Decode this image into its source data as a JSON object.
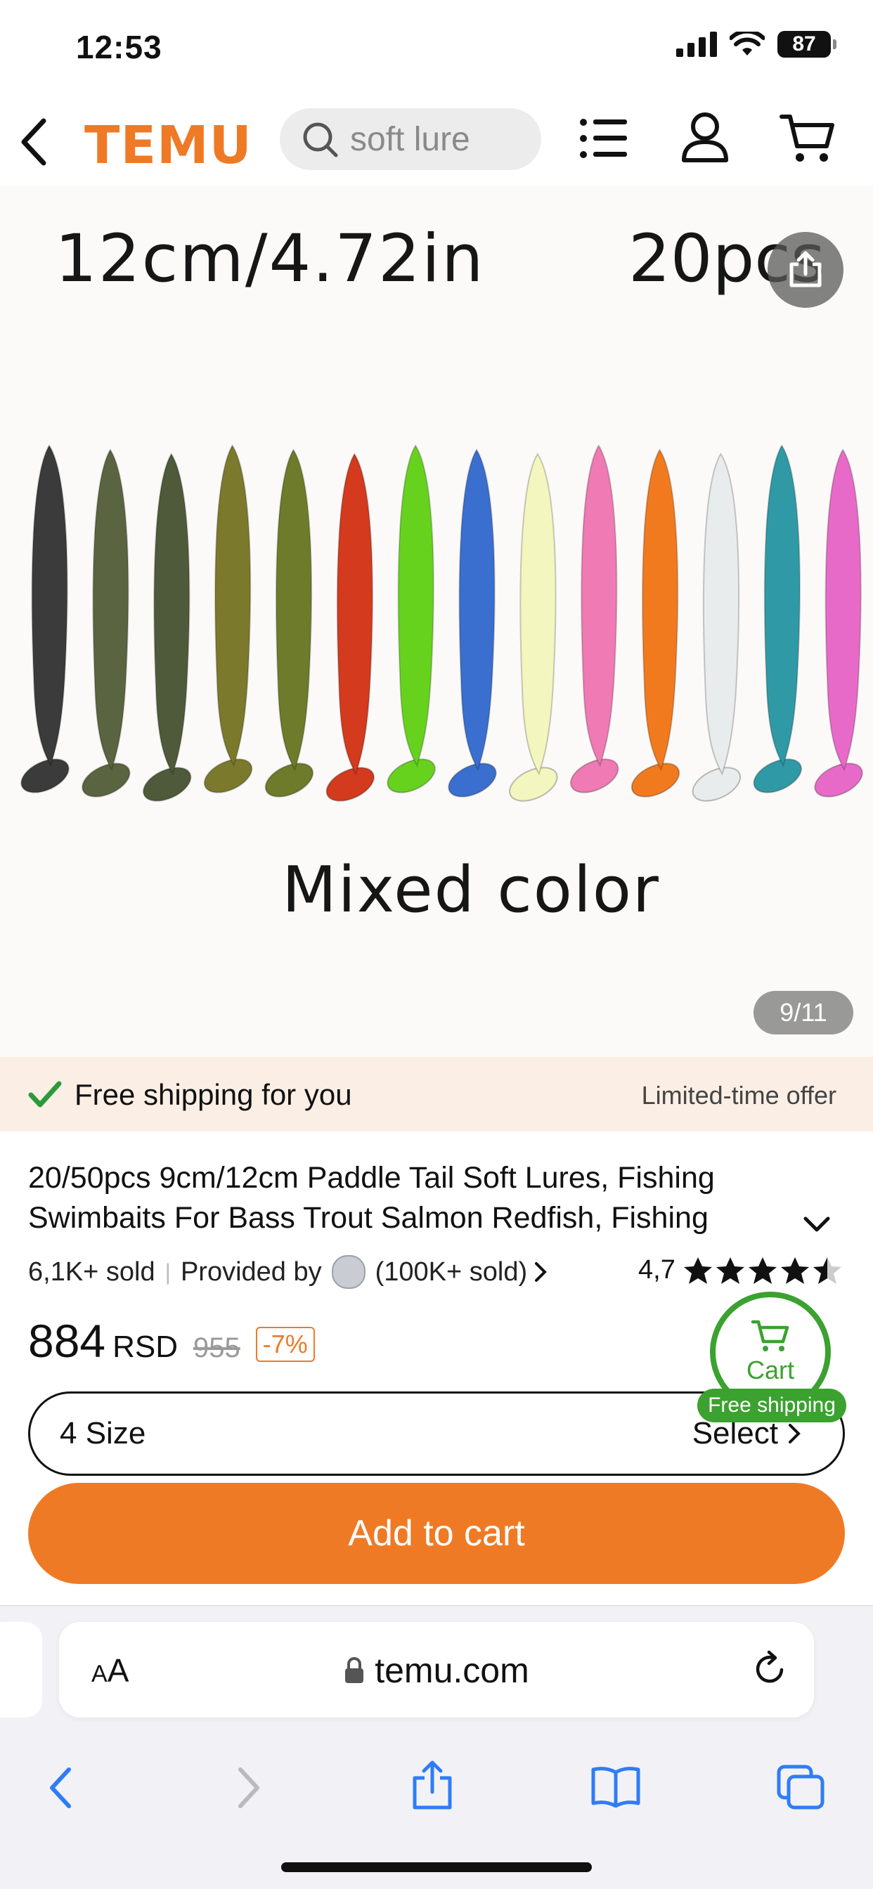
{
  "status": {
    "time": "12:53",
    "battery": "87"
  },
  "header": {
    "logo": "TEMU",
    "search_placeholder": "soft lure"
  },
  "gallery": {
    "size_text": "12cm/4.72in",
    "pcs_text": "20pcs",
    "caption": "Mixed color",
    "counter": "9/11",
    "lure_colors": [
      "#3b3b3b",
      "#5a6440",
      "#4f5a3a",
      "#7b7a2c",
      "#6e7b2a",
      "#d43a1e",
      "#66d21e",
      "#3a6fd0",
      "#f4f6c0",
      "#f07ab3",
      "#f27a1e",
      "#e9ecec",
      "#2f9aa6",
      "#e86ac8"
    ]
  },
  "shipping": {
    "title": "Free shipping for you",
    "offer": "Limited-time offer"
  },
  "product": {
    "title_line1": "20/50pcs 9cm/12cm Paddle Tail Soft Lures, Fishing",
    "title_line2": "Swimbaits For Bass Trout Salmon Redfish, Fishing",
    "sold": "6,1K+ sold",
    "provided_by": "Provided by",
    "store_sold": "(100K+ sold)",
    "rating": "4,7",
    "price": "884",
    "currency": "RSD",
    "old_price": "955",
    "discount": "-7%"
  },
  "size": {
    "label": "4 Size",
    "action": "Select"
  },
  "cart_float": {
    "label": "Cart",
    "badge": "Free shipping"
  },
  "add_to_cart": "Add to cart",
  "browser": {
    "text_size": "AA",
    "url": "temu.com"
  },
  "colors": {
    "accent": "#ef7a25",
    "green": "#3ba12f",
    "ios_blue": "#2f7cf6"
  }
}
